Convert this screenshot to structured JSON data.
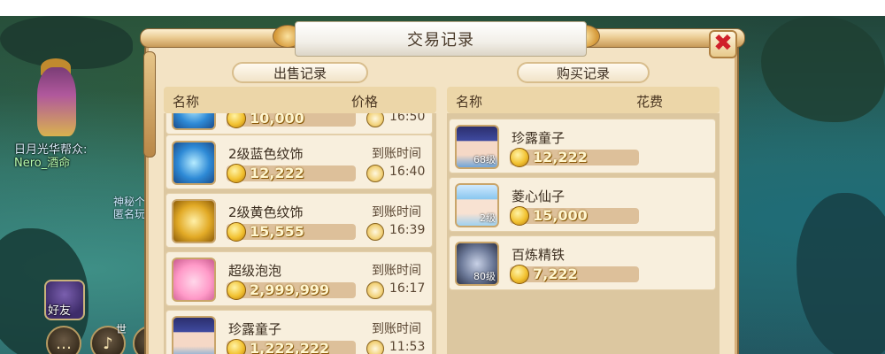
{
  "scene": {
    "guild_line1": "日月光华帮众:",
    "guild_line2": "Nero_酒命",
    "side_line1": "神秘个",
    "side_line2": "匿名玩",
    "friends_label": "好友",
    "world_tag": "世"
  },
  "dialog": {
    "title": "交易记录",
    "close_symbol": "✖",
    "sell": {
      "tab_label": "出售记录",
      "col_name": "名称",
      "col_price": "价格",
      "rows": [
        {
          "name": "",
          "price": "10,000",
          "time_label": "",
          "time": "16:50",
          "icon": "blue-ornament-icon",
          "style": "ic-blue"
        },
        {
          "name": "2级蓝色纹饰",
          "price": "12,222",
          "time_label": "到账时间",
          "time": "16:40",
          "icon": "blue-ornament-icon",
          "style": "ic-blue"
        },
        {
          "name": "2级黄色纹饰",
          "price": "15,555",
          "time_label": "到账时间",
          "time": "16:39",
          "icon": "yellow-ornament-icon",
          "style": "ic-gold"
        },
        {
          "name": "超级泡泡",
          "price": "2,999,999",
          "time_label": "到账时间",
          "time": "16:17",
          "icon": "pink-bubble-pet-icon",
          "style": "ic-pink"
        },
        {
          "name": "珍露童子",
          "price": "1,222,222",
          "time_label": "到账时间",
          "time": "11:53",
          "icon": "girl-pet-portrait-icon",
          "style": "ic-girl"
        }
      ]
    },
    "buy": {
      "tab_label": "购买记录",
      "col_name": "名称",
      "col_cost": "花费",
      "rows": [
        {
          "name": "珍露童子",
          "price": "12,222",
          "level": "68级",
          "icon": "girl-pet-portrait-icon",
          "style": "ic-girl"
        },
        {
          "name": "菱心仙子",
          "price": "15,000",
          "level": "2级",
          "icon": "fairy-pet-portrait-icon",
          "style": "ic-fairy"
        },
        {
          "name": "百炼精铁",
          "price": "7,222",
          "level": "80级",
          "icon": "iron-ore-icon",
          "style": "ic-iron"
        }
      ]
    }
  },
  "colors": {
    "dialog_bg": "#f3e3c4",
    "row_bg": "#f8efdd",
    "close_red": "#d0202a",
    "coin_gold": "#f2c231"
  }
}
